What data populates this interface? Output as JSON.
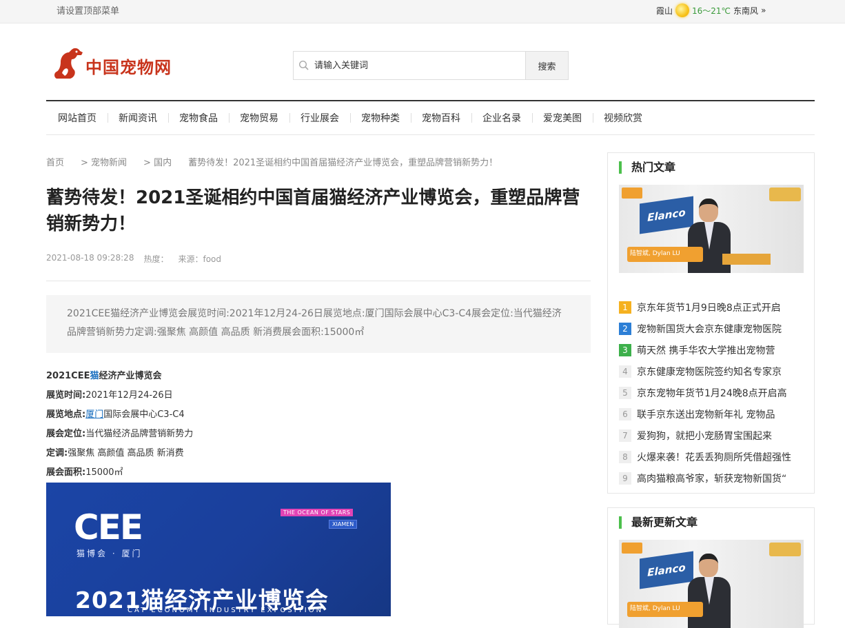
{
  "topbar": {
    "menu_text": "请设置顶部菜单",
    "weather": {
      "city": "霞山",
      "temp": "16～21℃",
      "wind": "东南风",
      "more": "»"
    }
  },
  "site": {
    "logo_text": "中国宠物网",
    "logo_colors": {
      "brand": "#c8341c"
    }
  },
  "search": {
    "placeholder": "请输入关键词",
    "button": "搜索"
  },
  "nav": {
    "items": [
      "网站首页",
      "新闻资讯",
      "宠物食品",
      "宠物贸易",
      "行业展会",
      "宠物种类",
      "宠物百科",
      "企业名录",
      "爱宠美图",
      "视频欣赏"
    ]
  },
  "breadcrumb": {
    "home": "首页",
    "level1": "> 宠物新闻",
    "level2": "> 国内",
    "current": "蓄势待发！2021圣诞相约中国首届猫经济产业博览会，重塑品牌营销新势力！"
  },
  "article": {
    "title": "蓄势待发！2021圣诞相约中国首届猫经济产业博览会，重塑品牌营销新势力！",
    "date": "2021-08-18 09:28:28",
    "heat_label": "热度：",
    "source_label": "来源：food",
    "summary": "2021CEE猫经济产业博览会展览时间:2021年12月24-26日展览地点:厦门国际会展中心C3-C4展会定位:当代猫经济品牌营销新势力定调:强聚焦 高颜值 高品质 新消费展会面积:15000㎡",
    "body": {
      "l1_a": "2021CEE",
      "l1_link": "猫",
      "l1_b": "经济产业博览会",
      "l2_label": "展览时间:",
      "l2_value": "2021年12月24-26日",
      "l3_label": "展览地点:",
      "l3_link": "厦门",
      "l3_value": "国际会展中心C3-C4",
      "l4_label": "展会定位:",
      "l4_value": "当代猫经济品牌营销新势力",
      "l5_label": "定调:",
      "l5_value": "强聚焦 高颜值 高品质 新消费",
      "l6_label": "展会面积:",
      "l6_value": "15000㎡"
    },
    "poster": {
      "logo": "CEE",
      "sub": "猫博会 · 厦门",
      "tag1": "THE OCEAN OF STARS",
      "tag2": "XIAMEN",
      "headline": "2021猫经济产业博览会",
      "english": "CAT ECONOMY INDUSTRY EXPOSITION"
    }
  },
  "sidebar": {
    "hot": {
      "title": "热门文章",
      "thumb": {
        "brand": "Elanco",
        "caption": "陆智斌, Dylan LU"
      },
      "items": [
        {
          "rank": "1",
          "text": "京东年货节1月9日晚8点正式开启"
        },
        {
          "rank": "2",
          "text": "宠物新国货大会京东健康宠物医院"
        },
        {
          "rank": "3",
          "text": "萌天然 携手华农大学推出宠物营"
        },
        {
          "rank": "4",
          "text": "京东健康宠物医院签约知名专家京"
        },
        {
          "rank": "5",
          "text": "京东宠物年货节1月24晚8点开启高"
        },
        {
          "rank": "6",
          "text": "联手京东送出宠物新年礼 宠物品"
        },
        {
          "rank": "7",
          "text": "爱狗狗，就把小宠肠胃宝围起来"
        },
        {
          "rank": "8",
          "text": "火爆来袭！花丢丢狗厕所凭借超强性"
        },
        {
          "rank": "9",
          "text": "高肉猫粮高爷家，斩获宠物新国货“"
        }
      ]
    },
    "latest": {
      "title": "最新更新文章",
      "thumb": {
        "brand": "Elanco",
        "caption": "陆智斌, Dylan LU"
      }
    }
  }
}
